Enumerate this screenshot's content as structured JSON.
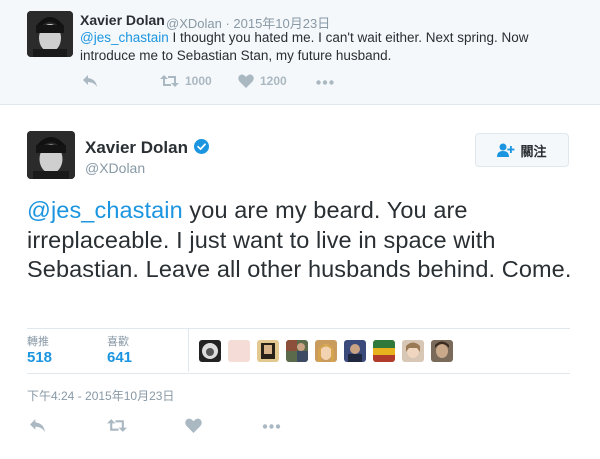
{
  "reply_tweet": {
    "name": "Xavier Dolan",
    "handle_time": "@XDolan · 2015年10月23日",
    "mention": "@jes_chastain",
    "text_line1": " I thought you hated me. I can't wait either. Next spring. Now",
    "text_line2": "introduce me to Sebastian Stan, my future husband.",
    "retweet_count": "1000",
    "like_count": "1200",
    "icons": [
      "reply-icon",
      "retweet-icon",
      "heart-icon",
      "more-icon"
    ]
  },
  "main_tweet": {
    "name": "Xavier Dolan",
    "handle": "@XDolan",
    "follow_label": "關注",
    "mention": "@jes_chastain",
    "text": " you are my beard. You are irreplaceable. I just want to live in space with Sebastian. Leave all other husbands behind. Come.",
    "stats": {
      "retweets_label": "轉推",
      "retweets_value": "518",
      "likes_label": "喜歡",
      "likes_value": "641"
    },
    "liker_avatar_count": 10,
    "timestamp": "下午4:24 - 2015年10月23日",
    "icons": [
      "reply-icon",
      "retweet-icon",
      "heart-icon",
      "more-icon",
      "verified-icon",
      "add-user-icon"
    ]
  },
  "colors": {
    "link": "#1b95e0",
    "text": "#292f33",
    "muted": "#8899a6",
    "icon": "#aab8c2",
    "top_bg": "#f5f8fa",
    "border": "#e1e8ed"
  }
}
